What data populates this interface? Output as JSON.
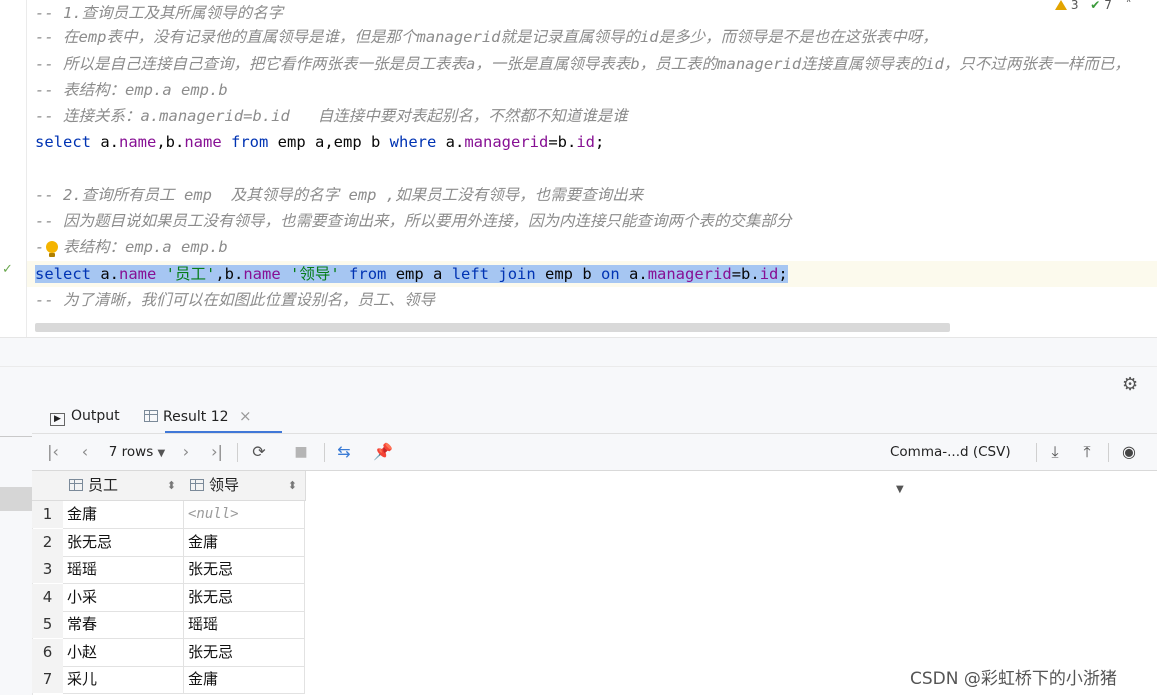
{
  "editor": {
    "inspections": {
      "warnings": "3",
      "checks": "7"
    },
    "lines": [
      {
        "type": "comment",
        "text": "-- 1.查询员工及其所属领导的名字"
      },
      {
        "type": "comment",
        "text": "-- 在emp表中，没有记录他的直属领导是谁，但是那个managerid就是记录直属领导的id是多少，而领导是不是也在这张表中呀，"
      },
      {
        "type": "comment",
        "text": "-- 所以是自己连接自己查询，把它看作两张表一张是员工表表a，一张是直属领导表表b，员工表的managerid连接直属领导表的id，只不过两张表一样而已，"
      },
      {
        "type": "comment",
        "text": "-- 表结构：emp.a emp.b"
      },
      {
        "type": "comment",
        "text": "-- 连接关系：a.managerid=b.id   自连接中要对表起别名，不然都不知道谁是谁"
      },
      {
        "type": "sql",
        "text": "select a.name,b.name from emp a,emp b where a.managerid=b.id;"
      },
      {
        "type": "blank",
        "text": ""
      },
      {
        "type": "comment",
        "text": "-- 2.查询所有员工 emp  及其领导的名字 emp ,如果员工没有领导，也需要查询出来"
      },
      {
        "type": "comment",
        "text": "-- 因为题目说如果员工没有领导，也需要查询出来，所以要用外连接，因为内连接只能查询两个表的交集部分"
      },
      {
        "type": "comment",
        "text": "-- 表结构：emp.a emp.b"
      },
      {
        "type": "sql",
        "text": "select a.name '员工',b.name '领导' from emp a left join emp b on a.managerid=b.id;"
      },
      {
        "type": "comment",
        "text": "-- 为了清晰，我们可以在如图此位置设别名，员工、领导"
      }
    ]
  },
  "tabs": [
    {
      "label": "Output",
      "icon": "output-icon"
    },
    {
      "label": "Result 12",
      "icon": "table-icon",
      "close": "×"
    }
  ],
  "toolbar": {
    "rows_label": "7 rows",
    "export_format": "Comma-...d (CSV)"
  },
  "grid": {
    "columns": [
      "员工",
      "领导"
    ],
    "rows": [
      {
        "n": "1",
        "c1": "金庸",
        "c2": "<null>"
      },
      {
        "n": "2",
        "c1": "张无忌",
        "c2": "金庸"
      },
      {
        "n": "3",
        "c1": "瑶瑶",
        "c2": "张无忌"
      },
      {
        "n": "4",
        "c1": "小采",
        "c2": "张无忌"
      },
      {
        "n": "5",
        "c1": "常春",
        "c2": "瑶瑶"
      },
      {
        "n": "6",
        "c1": "小赵",
        "c2": "张无忌"
      },
      {
        "n": "7",
        "c1": "采儿",
        "c2": "金庸"
      }
    ]
  },
  "watermark": "CSDN @彩虹桥下的小浙猪"
}
